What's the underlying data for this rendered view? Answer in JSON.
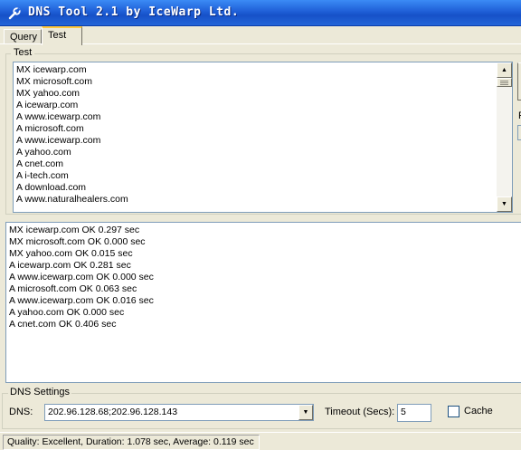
{
  "window": {
    "title": "DNS Tool 2.1 by IceWarp Ltd."
  },
  "tabs": [
    {
      "label": "Query",
      "active": false
    },
    {
      "label": "Test",
      "active": true
    }
  ],
  "test_group": {
    "label": "Test",
    "queries": [
      "MX icewarp.com",
      "MX microsoft.com",
      "MX yahoo.com",
      "A icewarp.com",
      "A www.icewarp.com",
      "A microsoft.com",
      "A www.icewarp.com",
      "A yahoo.com",
      "A cnet.com",
      "A i-tech.com",
      "A download.com",
      "A www.naturalhealers.com"
    ],
    "right_label_partial": "F"
  },
  "results": [
    "MX icewarp.com OK 0.297 sec",
    "MX microsoft.com OK 0.000 sec",
    "MX yahoo.com OK 0.015 sec",
    "A icewarp.com OK 0.281 sec",
    "A www.icewarp.com OK 0.000 sec",
    "A microsoft.com OK 0.063 sec",
    "A www.icewarp.com OK 0.016 sec",
    "A yahoo.com OK 0.000 sec",
    "A cnet.com OK 0.406 sec"
  ],
  "dns_settings": {
    "label": "DNS Settings",
    "dns_label": "DNS:",
    "dns_value": "202.96.128.68;202.96.128.143",
    "timeout_label": "Timeout (Secs):",
    "timeout_value": "5",
    "cache_label": "Cache",
    "cache_checked": false
  },
  "status": {
    "text": "Quality: Excellent, Duration: 1.078 sec, Average: 0.119 sec"
  },
  "icons": {
    "title": "wrench-icon",
    "scroll_up": "arrow-up-icon",
    "scroll_down": "arrow-down-icon",
    "dropdown": "chevron-down-icon"
  },
  "colors": {
    "titlebar": "#1f5fd7",
    "active_tab_highlight": "#ffc83c",
    "window_bg": "#ece9d8"
  }
}
